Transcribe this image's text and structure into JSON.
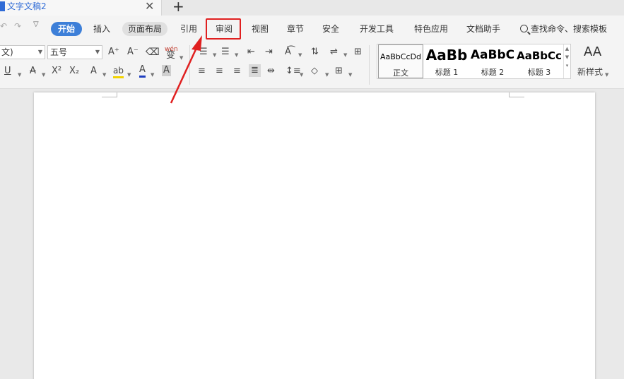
{
  "titlebar": {
    "doc_title": "文字文稿2",
    "close_symbol": "✕",
    "new_tab_symbol": "+"
  },
  "menu": {
    "undo_icon": "↶",
    "redo_icon": "↷",
    "tabs": [
      "开始",
      "插入",
      "页面布局",
      "引用",
      "审阅",
      "视图",
      "章节",
      "安全",
      "开发工具",
      "特色应用",
      "文档助手"
    ],
    "highlighted_tab": "审阅",
    "search_label": "查找命令、搜索模板"
  },
  "ribbon": {
    "font_name": "文)",
    "font_size": "五号",
    "grow_font": "A⁺",
    "shrink_font": "A⁻",
    "phonetic": "wén",
    "phonetic_char": "变",
    "underline": "U",
    "strike": "A",
    "superscript": "X²",
    "subscript": "X₂",
    "text_effect": "A",
    "highlight": "ab",
    "font_color": "A",
    "char_shading": "A",
    "styles": [
      {
        "sample": "AaBbCcDd",
        "name": "正文"
      },
      {
        "sample": "AaBb",
        "name": "标题 1"
      },
      {
        "sample": "AaBbC",
        "name": "标题 2"
      },
      {
        "sample": "AaBbCc",
        "name": "标题 3"
      }
    ],
    "new_style_label": "新样式",
    "new_style_icon": "AA"
  },
  "colors": {
    "accent": "#3d7fd8",
    "doc_blue": "#2f6bd6",
    "highlight_box": "#e02020",
    "font_color_bar": "#1f3fbf",
    "highlight_bar": "#f2d200"
  }
}
